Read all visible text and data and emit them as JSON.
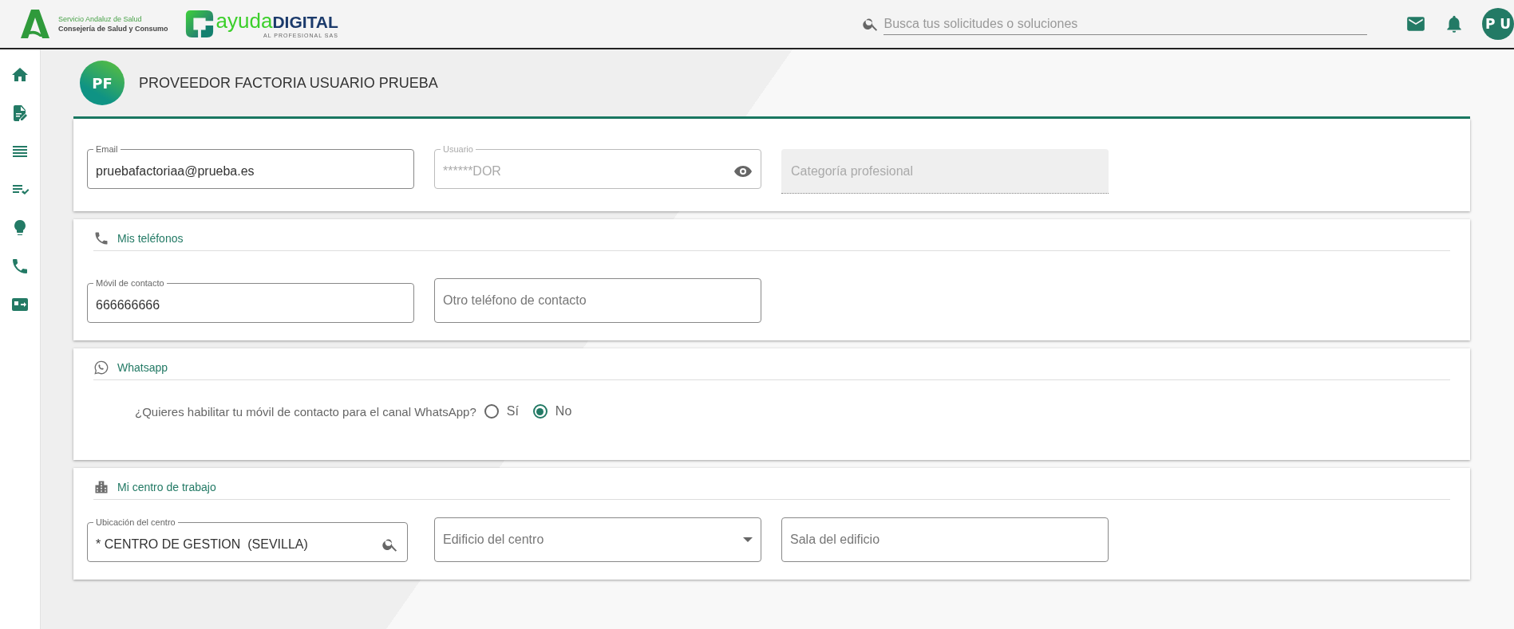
{
  "header": {
    "org": [
      "Servicio Andaluz de Salud",
      "Consejería de Salud y Consumo"
    ],
    "brand": {
      "light": "ayuda",
      "bold": "DIGITAL",
      "tagline": "AL PROFESIONAL SAS"
    },
    "search": {
      "placeholder": "Busca tus solicitudes o soluciones"
    },
    "avatar": "P U"
  },
  "profile": {
    "initials": "PF",
    "name": "PROVEEDOR FACTORIA USUARIO PRUEBA"
  },
  "sections": [
    {
      "kind": "fields",
      "fields": [
        {
          "kind": "text",
          "label": "Email",
          "value": "pruebafactoriaa@prueba.es",
          "disabled": false
        },
        {
          "kind": "password",
          "label": "Usuario",
          "value": "******DOR",
          "disabled": true
        },
        {
          "kind": "filled",
          "placeholder": "Categoría profesional",
          "disabled": true
        }
      ]
    },
    {
      "kind": "fields",
      "title": "Mis teléfonos",
      "fields": [
        {
          "kind": "text",
          "label": "Móvil de contacto",
          "value": "666666666",
          "disabled": false
        },
        {
          "kind": "text",
          "placeholder": "Otro teléfono de contacto",
          "disabled": false
        }
      ]
    },
    {
      "kind": "radio",
      "title": "Whatsapp",
      "question": "¿Quieres habilitar tu móvil de contacto para el canal WhatsApp?",
      "options": [
        {
          "label": "Sí",
          "selected": false
        },
        {
          "label": "No",
          "selected": true
        }
      ]
    },
    {
      "kind": "fields",
      "title": "Mi centro de trabajo",
      "fields": [
        {
          "kind": "search",
          "label": "Ubicación del centro",
          "value": "* CENTRO DE GESTION  (SEVILLA)",
          "disabled": false
        },
        {
          "kind": "select",
          "placeholder": "Edificio del centro",
          "disabled": false
        },
        {
          "kind": "text",
          "placeholder": "Sala del edificio",
          "disabled": false
        }
      ]
    }
  ]
}
